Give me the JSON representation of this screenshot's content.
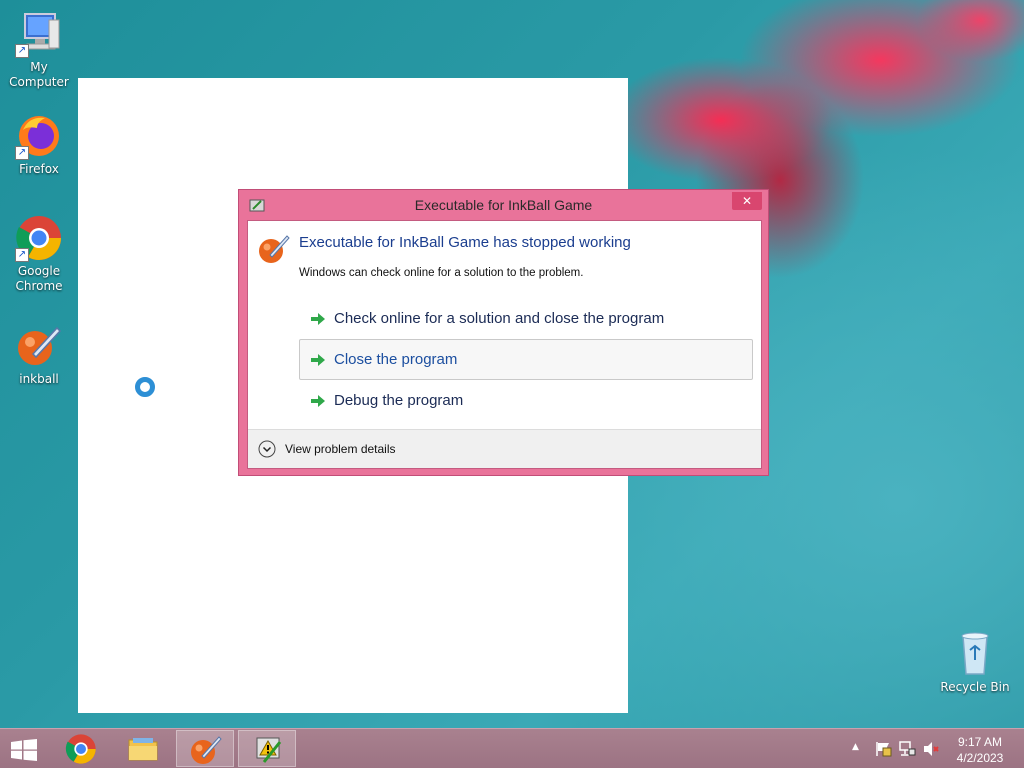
{
  "desktop": {
    "icons": [
      {
        "label": "My Computer"
      },
      {
        "label": "Firefox"
      },
      {
        "label": "Google Chrome"
      },
      {
        "label": "inkball"
      },
      {
        "label": "Recycle Bin"
      }
    ]
  },
  "dialog": {
    "title": "Executable for InkBall Game",
    "close_label": "✕",
    "heading": "Executable for InkBall Game has stopped working",
    "subtext": "Windows can check online for a solution to the problem.",
    "options": [
      {
        "label": "Check online for a solution and close the program"
      },
      {
        "label": "Close the program"
      },
      {
        "label": "Debug the program"
      }
    ],
    "details_label": "View problem details"
  },
  "taskbar": {
    "clock_time": "9:17 AM",
    "clock_date": "4/2/2023",
    "tray_arrow": "▲"
  },
  "colors": {
    "dialog_frame": "#e9739a",
    "heading_blue": "#1b3e8f",
    "taskbar": "#9c7383"
  }
}
